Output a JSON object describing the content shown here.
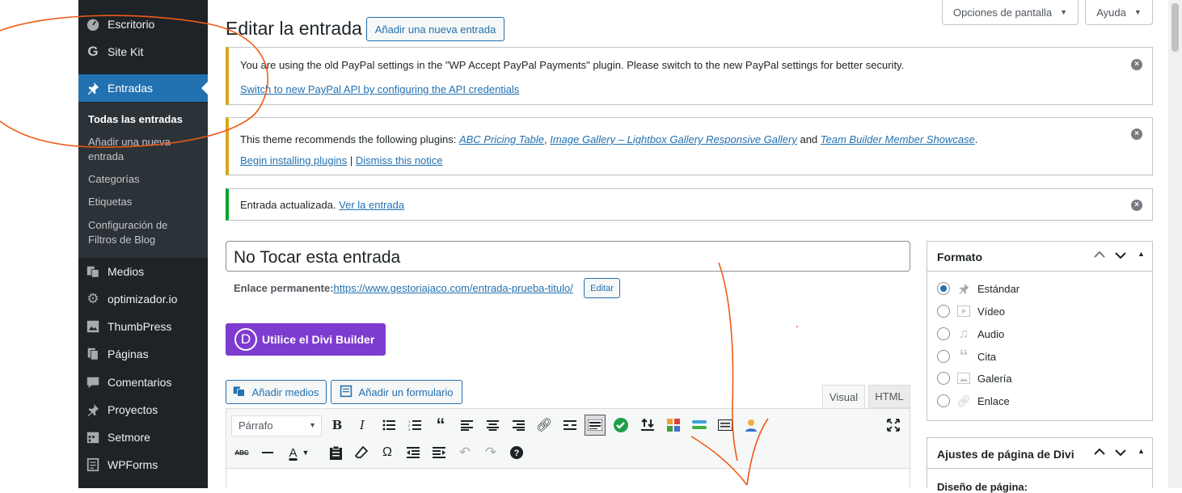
{
  "sidebar": {
    "items": [
      {
        "label": "Escritorio",
        "icon": "dashboard-icon"
      },
      {
        "label": "Site Kit",
        "icon": "sitekit-g-icon"
      },
      {
        "label": "Entradas",
        "icon": "pin-icon"
      },
      {
        "label": "Medios",
        "icon": "media-icon"
      },
      {
        "label": "optimizador.io",
        "icon": "gear-icon"
      },
      {
        "label": "ThumbPress",
        "icon": "image-icon"
      },
      {
        "label": "Páginas",
        "icon": "pages-icon"
      },
      {
        "label": "Comentarios",
        "icon": "comment-icon"
      },
      {
        "label": "Proyectos",
        "icon": "pin-icon"
      },
      {
        "label": "Setmore",
        "icon": "calendar-icon"
      },
      {
        "label": "WPForms",
        "icon": "forms-icon"
      }
    ],
    "submenu": [
      "Todas las entradas",
      "Añadir una nueva entrada",
      "Categorías",
      "Etiquetas",
      "Configuración de Filtros de Blog"
    ]
  },
  "screen_options": {
    "options_label": "Opciones de pantalla",
    "help_label": "Ayuda"
  },
  "header": {
    "title": "Editar la entrada",
    "add_new_label": "Añadir una nueva entrada"
  },
  "notices": {
    "paypal": {
      "text": "You are using the old PayPal settings in the \"WP Accept PayPal Payments\" plugin. Please switch to the new PayPal settings for better security.",
      "link": "Switch to new PayPal API by configuring the API credentials"
    },
    "theme": {
      "prefix": "This theme recommends the following plugins: ",
      "plugin1": "ABC Pricing Table",
      "sep1": ", ",
      "plugin2": "Image Gallery – Lightbox Gallery Responsive Gallery",
      "and": " and ",
      "plugin3": "Team Builder Member Showcase",
      "period": ".",
      "begin_link": "Begin installing plugins",
      "pipe": " | ",
      "dismiss_link": "Dismiss this notice"
    },
    "updated": {
      "text": "Entrada actualizada. ",
      "link": "Ver la entrada"
    }
  },
  "post": {
    "title_value": "No Tocar esta entrada",
    "permalink_label": "Enlace permanente: ",
    "permalink_url": "https://www.gestoriajaco.com/entrada-prueba-titulo/",
    "edit_label": "Editar",
    "divi_label": "Utilice el Divi Builder",
    "divi_letter": "D"
  },
  "editor": {
    "add_media_label": "Añadir medios",
    "add_form_label": "Añadir un formulario",
    "tab_visual": "Visual",
    "tab_html": "HTML",
    "format_select": "Párrafo",
    "bold": "B",
    "italic": "I",
    "color_letter": "A"
  },
  "formato_panel": {
    "title": "Formato",
    "options": [
      {
        "label": "Estándar",
        "icon": "pin-icon",
        "checked": true
      },
      {
        "label": "Vídeo",
        "icon": "video-icon",
        "checked": false
      },
      {
        "label": "Audio",
        "icon": "music-icon",
        "checked": false
      },
      {
        "label": "Cita",
        "icon": "quote-icon",
        "checked": false
      },
      {
        "label": "Galería",
        "icon": "gallery-icon",
        "checked": false
      },
      {
        "label": "Enlace",
        "icon": "link-icon",
        "checked": false
      }
    ]
  },
  "divi_panel": {
    "title": "Ajustes de página de Divi",
    "first_field": "Diseño de página:"
  },
  "colors": {
    "sidebar_bg": "#1d2327",
    "active": "#2271b1",
    "divi": "#7e3bd0",
    "warning": "#dba617",
    "success": "#00a32a",
    "annotation": "#f05a16"
  }
}
